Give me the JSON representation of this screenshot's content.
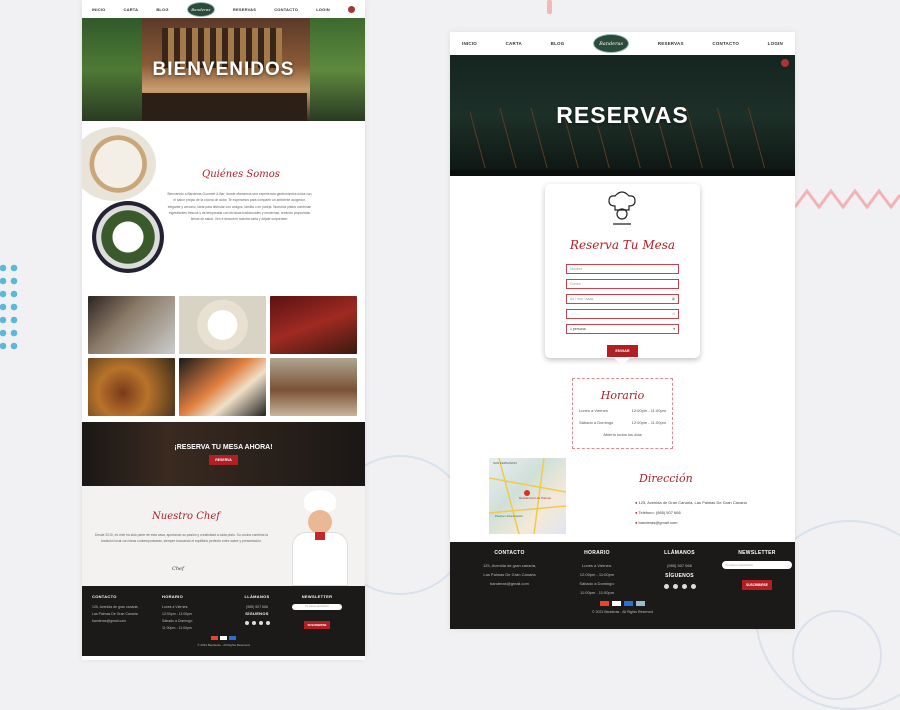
{
  "nav": {
    "inicio": "INICIO",
    "carta": "CARTA",
    "blog": "BLOG",
    "reservas": "RESERVAS",
    "contacto": "CONTACTO",
    "login": "LOGIN",
    "logo": "Banderas"
  },
  "left": {
    "hero_title": "BIENVENIDOS",
    "about_title": "Quiénes Somos",
    "about_text": "Bienvenido a Banderas Gourmet & Bar, donde ofrecemos una experiencia gastronómica única con el sabor propio de la cocina de autor. Te esperamos para compartir un ambiente acogedor, elegante y cercano, ideal para disfrutar con amigos, familia o en pareja. Nuestros platos combinan ingredientes frescos y de temporada con técnicas tradicionales y modernas, creando propuestas llenas de sabor. Ven a descubrir nuestra carta y déjate sorprender.",
    "cta_title": "¡RESERVA TU MESA AHORA!",
    "cta_button": "RESERVA",
    "chef_title": "Nuestro Chef",
    "chef_text": "Desde 2010, mi chef ha sido parte de esta casa, aportando su pasión y creatividad a cada plato. Su cocina combina la tradición local con ideas contemporáneas, siempre buscando el equilibrio perfecto entre sabor y presentación.",
    "signature": "Chef"
  },
  "right": {
    "hero_title": "RESERVAS",
    "form_title": "Reserva Tu Mesa",
    "name_placeholder": "Nombre",
    "email_placeholder": "Correo",
    "date_placeholder": "dd / mm / aaaa",
    "time_placeholder": "- - : - -",
    "persons_value": "1 persona",
    "submit": "ENVIAR",
    "horario_title": "Horario",
    "hours": [
      {
        "day": "Lunes a Viernes",
        "time": "12:00pm - 11:00pm"
      },
      {
        "day": "Sábado a Domingo",
        "time": "12:00pm - 11:00pm"
      }
    ],
    "open_note": "Abierto todos los días",
    "direccion_title": "Dirección",
    "address": "125, Avenida de Gran Canaria, Las Palmas De Gran Canaria",
    "phone": "Teléfono: (985) 507 666",
    "email": "banderas@gmail.com",
    "map_labels": [
      "SAN FERNANDO",
      "Residencial Las Palmas",
      "Parque Urbanización"
    ]
  },
  "footer": {
    "contacto_title": "CONTACTO",
    "contacto_lines": [
      "125, Avenida de gran canaria,",
      "Las Palmas De Gran Canaria",
      "banderas@gmail.com"
    ],
    "horario_title": "HORARIO",
    "horario_lines": [
      "Lunes a Viernes:",
      "12:00pm - 11:00pm",
      "Sábado a Domingo:",
      "11:00pm - 11:00pm"
    ],
    "llamanos_title": "LLÁMANOS",
    "phone": "(985) 507 666",
    "siguenos": "SÍGUENOS",
    "newsletter_title": "NEWSLETTER",
    "newsletter_placeholder": "Tu correo electrónico",
    "subscribe": "SUSCRIBIRSE",
    "copyright": "© 2021 Banderas - All Rights Reserved"
  },
  "colors": {
    "accent": "#b01f24",
    "logo": "#2a4a3a",
    "footer": "#1b1a19"
  },
  "icons": [
    "cart-icon",
    "chef-icon",
    "location-icon",
    "phone-icon",
    "mail-icon",
    "facebook-icon",
    "instagram-icon",
    "twitter-icon",
    "whatsapp-icon"
  ]
}
